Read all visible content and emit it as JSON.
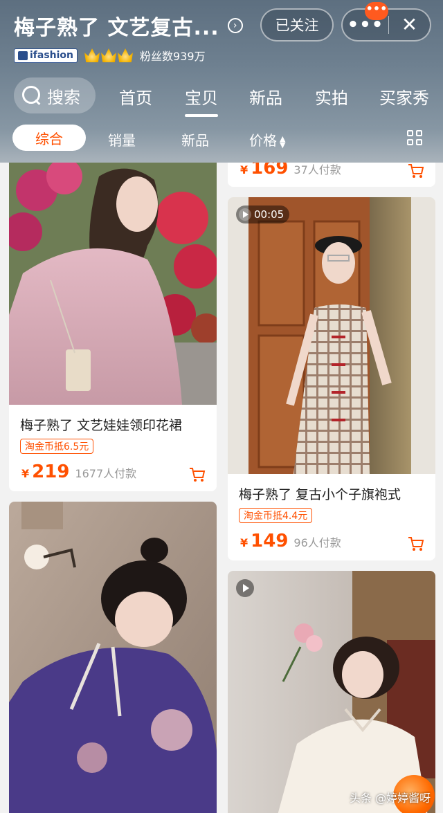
{
  "header": {
    "store_title": "梅子熟了 文艺复古...",
    "follow_label": "已关注",
    "more_label": "•••",
    "notification_badge": "•••",
    "close_label": "✕",
    "badge_text": "ifashion",
    "crown_count": 3,
    "fans_text": "粉丝数939万"
  },
  "nav": {
    "search_label": "搜索",
    "tabs": [
      {
        "label": "首页",
        "active": false
      },
      {
        "label": "宝贝",
        "active": true
      },
      {
        "label": "新品",
        "active": false
      },
      {
        "label": "实拍",
        "active": false
      },
      {
        "label": "买家秀",
        "active": false
      }
    ]
  },
  "filters": {
    "items": [
      {
        "label": "综合",
        "active": true
      },
      {
        "label": "销量",
        "active": false
      },
      {
        "label": "新品",
        "active": false
      },
      {
        "label": "价格",
        "active": false
      }
    ],
    "price_sort_icon": "sort-up-down-icon",
    "layout_icon": "grid-view-icon"
  },
  "products": [
    {
      "title": "梅子熟了 文艺娃娃领印花裙",
      "coupon": "淘金币抵6.5元",
      "currency": "¥",
      "price": "219",
      "paid": "1677人付款"
    },
    {
      "title": "",
      "coupon": "",
      "currency": "¥",
      "price": "169",
      "paid": "37人付款"
    },
    {
      "title": "梅子熟了 复古小个子旗袍式",
      "coupon": "淘金币抵4.4元",
      "currency": "¥",
      "price": "149",
      "paid": "96人付款",
      "video_duration": "00:05"
    }
  ],
  "watermark": "头条 @婷婷酱呀",
  "colors": {
    "accent": "#ff5000",
    "header_bg": "#6e8090"
  }
}
